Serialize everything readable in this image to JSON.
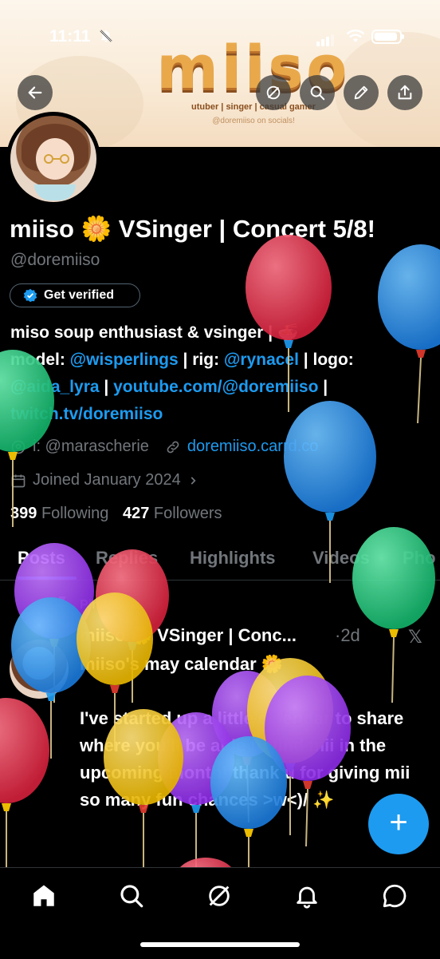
{
  "status_bar": {
    "time": "11:11"
  },
  "banner": {
    "logo_text": "miiso",
    "tagline": "utuber | singer | casual gamer",
    "socials": "@doremiiso on socials!"
  },
  "profile": {
    "display_name": "miiso 🌼 VSinger | Concert 5/8!",
    "handle": "@doremiiso",
    "verify_label": "Get verified",
    "bio": {
      "line1": "miso soup enthusiast & vsinger | 🍜",
      "model_label": "model: ",
      "model_link": "@wisperlings",
      "rig_label": " | rig: ",
      "rig_link": "@rynacel",
      "logo_label": " | logo:",
      "logo_link": "@aida_lyra",
      "sep": " | ",
      "youtube_link": "youtube.com/@doremiiso",
      "sep2": " |",
      "twitch_link": "twitch.tv/doremiiso"
    },
    "meta": {
      "icon_credit": "i: @marascherie",
      "website": "doremiiso.carrd.co",
      "joined": "Joined January 2024"
    },
    "following_count": "399",
    "following_label": "Following",
    "followers_count": "427",
    "followers_label": "Followers"
  },
  "tabs": [
    "Posts",
    "Replies",
    "Highlights",
    "Videos",
    "Pho"
  ],
  "pinned_post": {
    "pinned_label": "Pinned",
    "author": "miiso 🌼 VSinger | Conc...",
    "time": "·2d",
    "text": "miiso's may calendar 🌼\n\nI've started up a little calendar to share where you'll be able to find mii in the upcoming month! thank u for giving mii so many fun chances >w<)/ ✨"
  },
  "colors": {
    "accent": "#1d9bf0",
    "background": "#000000",
    "secondary_text": "#71767b"
  },
  "icons": [
    "back-arrow-icon",
    "grok-icon",
    "search-icon",
    "edit-icon",
    "share-icon",
    "verified-badge-icon",
    "link-icon",
    "calendar-icon",
    "pin-icon",
    "x-logo-icon",
    "home-icon",
    "explore-icon",
    "grok-nav-icon",
    "notifications-icon",
    "messages-icon",
    "plus-icon"
  ]
}
